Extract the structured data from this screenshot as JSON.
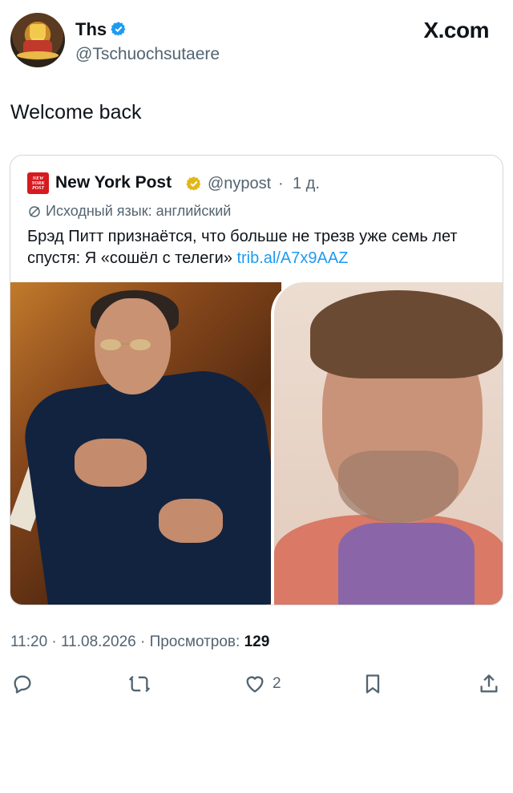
{
  "author": {
    "name": "Ths",
    "handle": "@Tschuochsutaere"
  },
  "site": "X.com",
  "tweet_text": "Welcome back",
  "quoted": {
    "logo_text": [
      "NEW",
      "YORK",
      "POST"
    ],
    "name": "New York Post",
    "handle": "@nypost",
    "dot": "·",
    "time": "1 д.",
    "lang_note": "Исходный язык: английский",
    "text": "Брэд Питт признаётся, что больше не трезв уже семь лет спустя: Я «сошёл с телеги» ",
    "link": "trib.al/A7x9AAZ"
  },
  "meta": {
    "time_date_prefix": "11:20 · 11.08.2026 · Просмотров: ",
    "views": "129"
  },
  "actions": {
    "like_count": "2"
  },
  "colors": {
    "verified_blue": "#1d9bf0",
    "verified_gold": "#e2b719",
    "link": "#1d9bf0",
    "muted": "#536471"
  }
}
